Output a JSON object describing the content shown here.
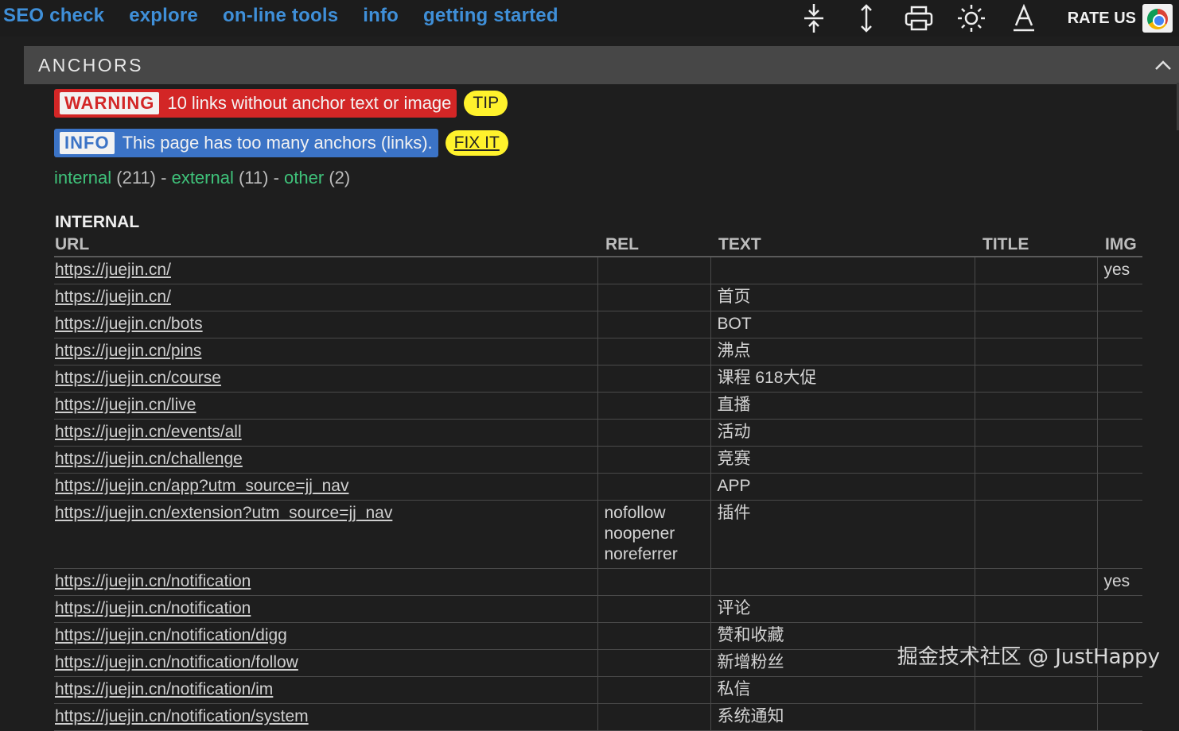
{
  "nav": {
    "items": [
      "SEO check",
      "explore",
      "on-line tools",
      "info",
      "getting started"
    ]
  },
  "toolbar": {
    "icons": [
      "collapse-vertical-icon",
      "expand-vertical-icon",
      "print-icon",
      "brightness-icon",
      "font-icon"
    ],
    "rate_label": "RATE US"
  },
  "section": {
    "title": "ANCHORS"
  },
  "messages": {
    "warning": {
      "label": "WARNING",
      "text": "10 links without anchor text or image",
      "action": "TIP"
    },
    "info": {
      "label": "INFO",
      "text": "This page has too many anchors (links).",
      "action": "FIX IT"
    }
  },
  "summary": {
    "internal_label": "internal",
    "internal_count": "(211)",
    "sep1": " - ",
    "external_label": "external",
    "external_count": "(11)",
    "sep2": " - ",
    "other_label": "other",
    "other_count": "(2)"
  },
  "table": {
    "title": "INTERNAL",
    "headers": {
      "url": "URL",
      "rel": "REL",
      "text": "TEXT",
      "title": "TITLE",
      "img": "IMG"
    },
    "rows": [
      {
        "url": "https://juejin.cn/",
        "rel": "",
        "text": "",
        "title": "",
        "img": "yes"
      },
      {
        "url": "https://juejin.cn/",
        "rel": "",
        "text": "首页",
        "title": "",
        "img": ""
      },
      {
        "url": "https://juejin.cn/bots",
        "rel": "",
        "text": "BOT",
        "title": "",
        "img": ""
      },
      {
        "url": "https://juejin.cn/pins",
        "rel": "",
        "text": "沸点",
        "title": "",
        "img": ""
      },
      {
        "url": "https://juejin.cn/course",
        "rel": "",
        "text": "课程 618大促",
        "title": "",
        "img": ""
      },
      {
        "url": "https://juejin.cn/live",
        "rel": "",
        "text": "直播",
        "title": "",
        "img": ""
      },
      {
        "url": "https://juejin.cn/events/all",
        "rel": "",
        "text": "活动",
        "title": "",
        "img": ""
      },
      {
        "url": "https://juejin.cn/challenge",
        "rel": "",
        "text": "竞赛",
        "title": "",
        "img": ""
      },
      {
        "url": "https://juejin.cn/app?utm_source=jj_nav",
        "rel": "",
        "text": "APP",
        "title": "",
        "img": ""
      },
      {
        "url": "https://juejin.cn/extension?utm_source=jj_nav",
        "rel": "nofollow\nnoopener\nnoreferrer",
        "text": "插件",
        "title": "",
        "img": ""
      },
      {
        "url": "https://juejin.cn/notification",
        "rel": "",
        "text": "",
        "title": "",
        "img": "yes"
      },
      {
        "url": "https://juejin.cn/notification",
        "rel": "",
        "text": "评论",
        "title": "",
        "img": ""
      },
      {
        "url": "https://juejin.cn/notification/digg",
        "rel": "",
        "text": "赞和收藏",
        "title": "",
        "img": ""
      },
      {
        "url": "https://juejin.cn/notification/follow",
        "rel": "",
        "text": "新增粉丝",
        "title": "",
        "img": ""
      },
      {
        "url": "https://juejin.cn/notification/im",
        "rel": "",
        "text": "私信",
        "title": "",
        "img": ""
      },
      {
        "url": "https://juejin.cn/notification/system",
        "rel": "",
        "text": "系统通知",
        "title": "",
        "img": ""
      }
    ]
  },
  "watermark": "掘金技术社区 @ JustHappy"
}
